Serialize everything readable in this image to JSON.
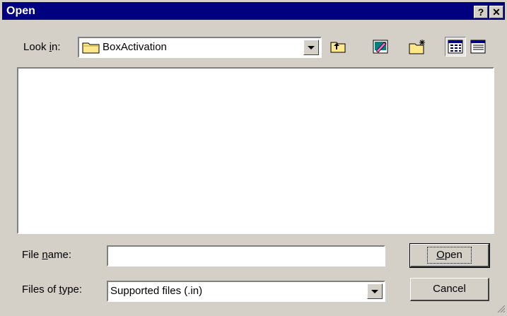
{
  "window": {
    "title": "Open",
    "help_label": "?",
    "close_label": "✕"
  },
  "look_in": {
    "label_pre": "Look ",
    "label_u": "i",
    "label_post": "n:",
    "value": "BoxActivation",
    "folder_icon": "folder-icon"
  },
  "toolbar": {
    "icons": [
      "up-one-level-icon",
      "desktop-icon",
      "new-folder-icon",
      "list-view-icon",
      "details-view-icon"
    ]
  },
  "file_list": {
    "items": []
  },
  "file_name": {
    "label_pre": "File ",
    "label_u": "n",
    "label_post": "ame:",
    "value": ""
  },
  "file_type": {
    "label_pre": "Files of ",
    "label_u": "t",
    "label_post": "ype:",
    "value": "Supported files (.in)"
  },
  "buttons": {
    "open_u": "O",
    "open_rest": "pen",
    "cancel": "Cancel"
  }
}
